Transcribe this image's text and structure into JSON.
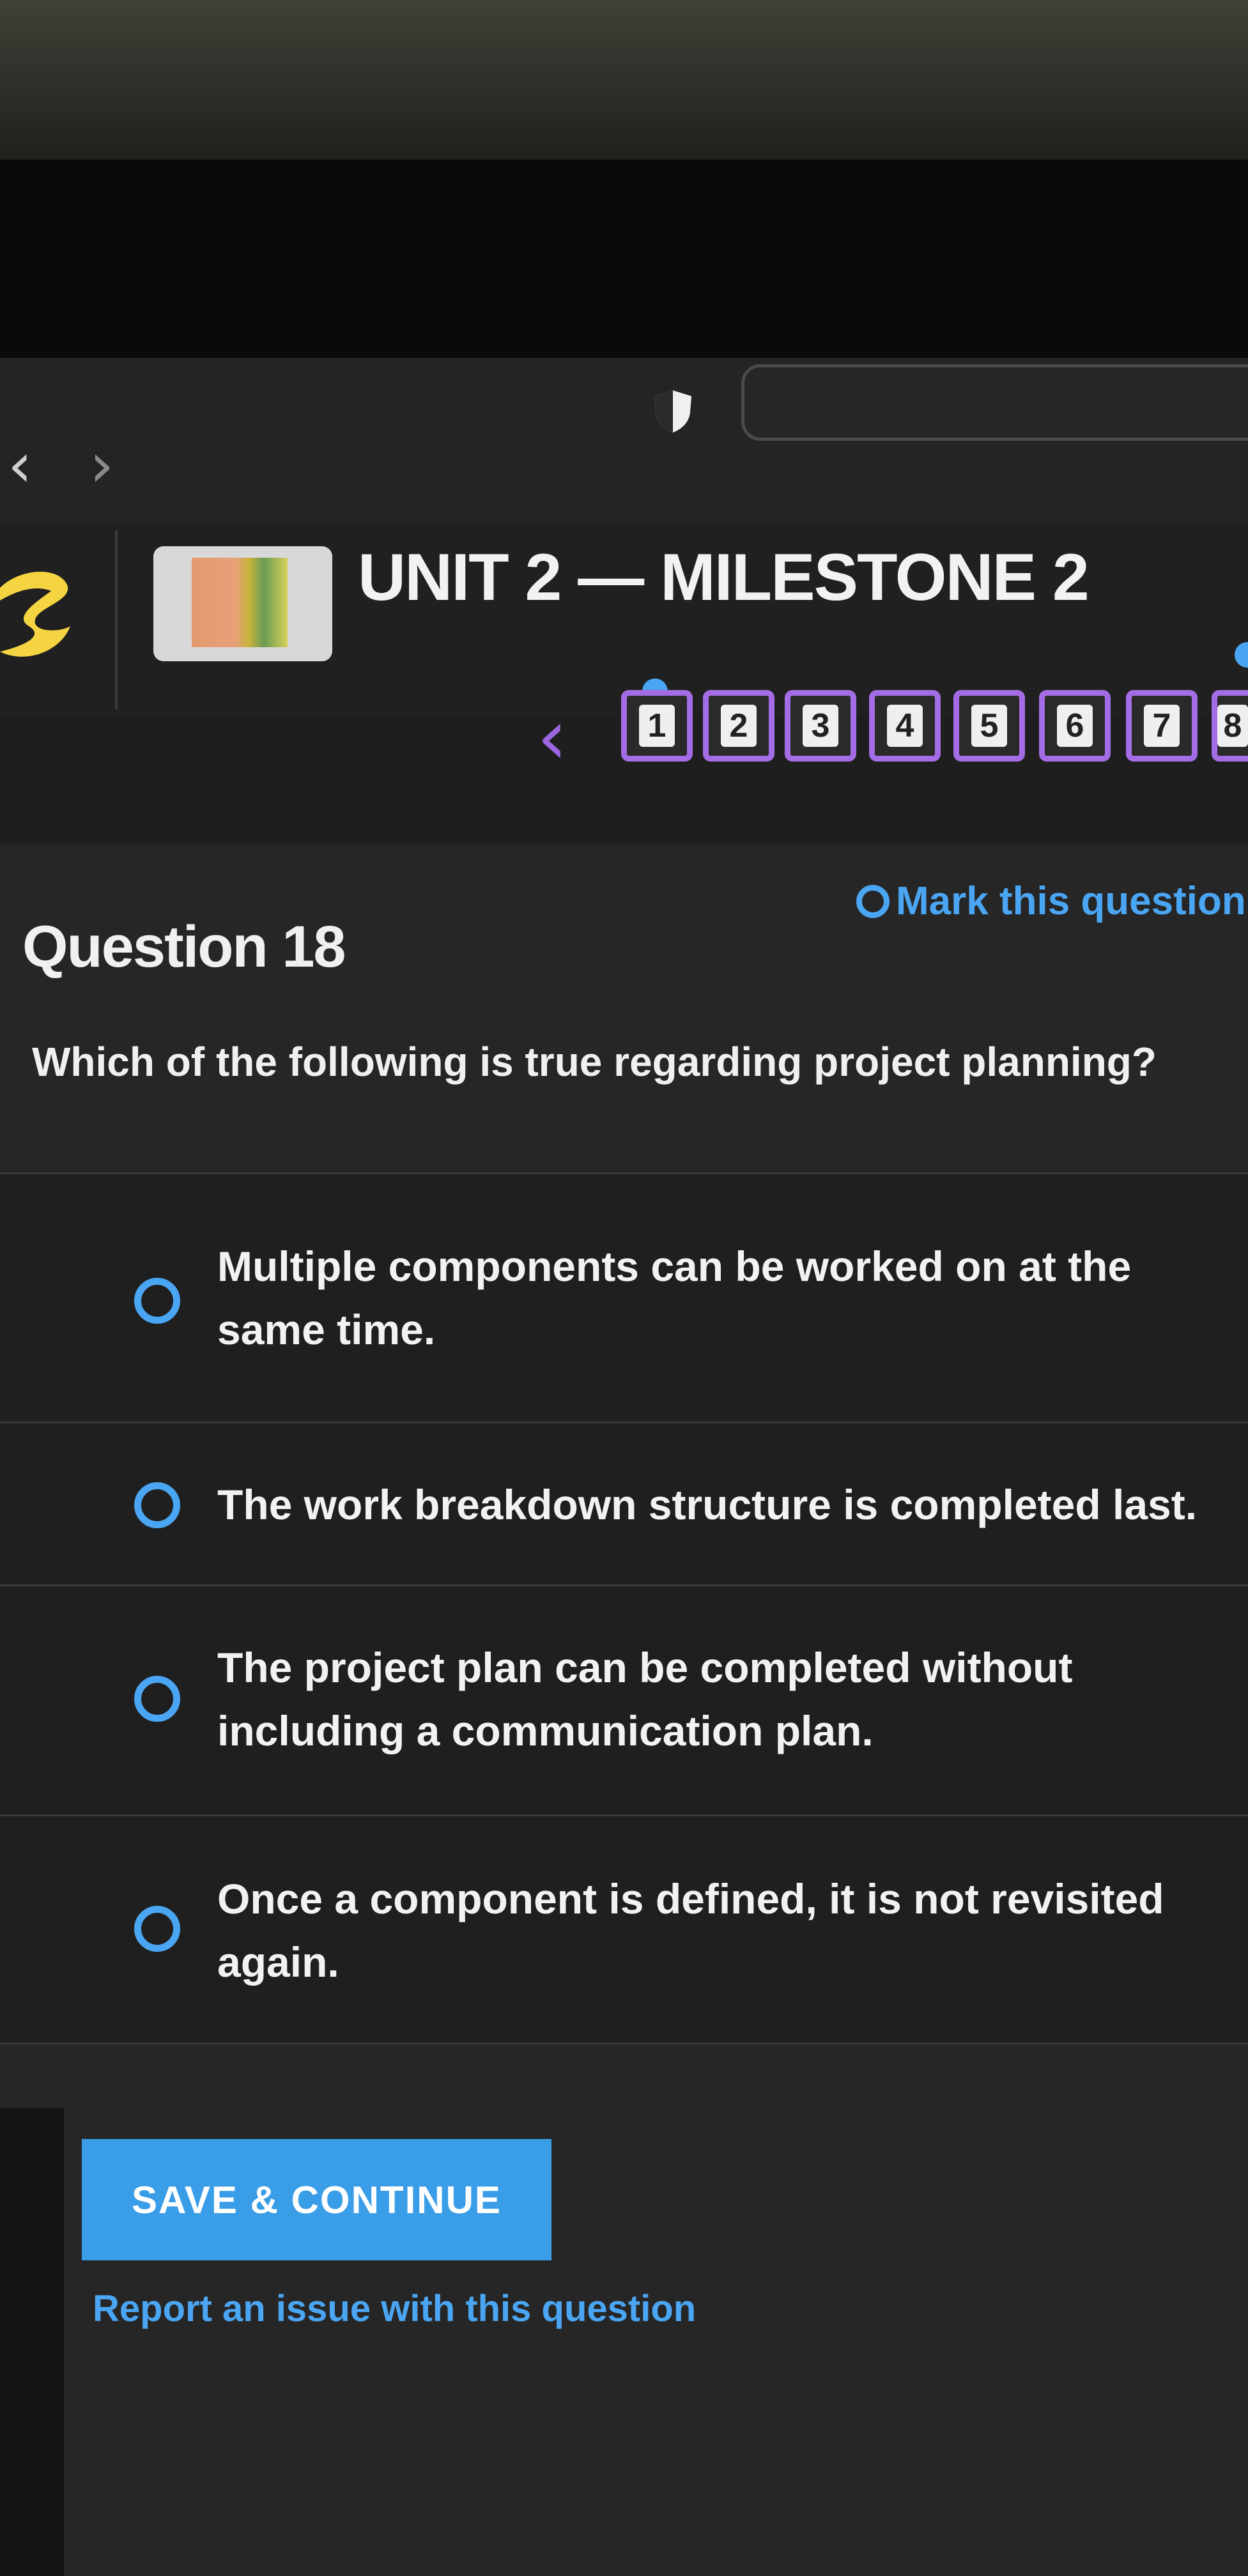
{
  "browser": {
    "back_glyph": "‹",
    "forward_glyph": "›",
    "shield_icon": "shield-icon",
    "address": ""
  },
  "header": {
    "unit_title": "UNIT 2 — MILESTONE 2",
    "logo_icon": "sophia-logo-icon",
    "logo_color": "#f5d442"
  },
  "question_nav": {
    "prev_glyph": "‹",
    "items": [
      "1",
      "2",
      "3",
      "4",
      "5",
      "6",
      "7",
      "8"
    ],
    "accent_color": "#a46de6"
  },
  "question": {
    "number_label": "Question 18",
    "mark_label": "Mark this question",
    "text": "Which of the following is true regarding project planning?",
    "options": [
      {
        "text": "Multiple components can be worked on at the same time."
      },
      {
        "text": "The work breakdown structure is completed last."
      },
      {
        "text": "The project plan can be completed without including a communication plan."
      },
      {
        "text": "Once a component is defined, it is not revisited again."
      }
    ]
  },
  "actions": {
    "save_label": "SAVE & CONTINUE",
    "report_label": "Report an issue with this question",
    "accent_color": "#3a9de8"
  }
}
